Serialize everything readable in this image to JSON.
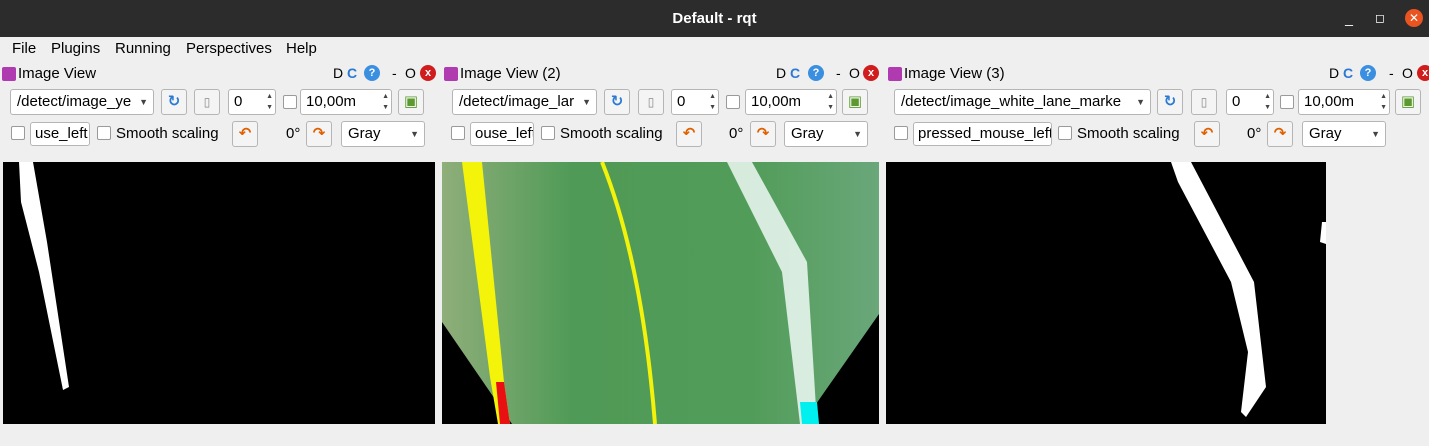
{
  "window": {
    "title": "Default - rqt",
    "min": "_",
    "max": "◻",
    "close": "✕"
  },
  "menu": [
    "File",
    "Plugins",
    "Running",
    "Perspectives",
    "Help"
  ],
  "panels": [
    {
      "title": "Image View",
      "topic": "/detect/image_ye",
      "spin": "0",
      "delay": "10,00m",
      "mouse_topic": "use_left",
      "smooth": "Smooth scaling",
      "rotation": "0°",
      "color": "Gray"
    },
    {
      "title": "Image View (2)",
      "topic": "/detect/image_lar",
      "spin": "0",
      "delay": "10,00m",
      "mouse_topic": "ouse_left",
      "smooth": "Smooth scaling",
      "rotation": "0°",
      "color": "Gray"
    },
    {
      "title": "Image View (3)",
      "topic": "/detect/image_white_lane_marke",
      "spin": "0",
      "delay": "10,00m",
      "mouse_topic": "pressed_mouse_left",
      "smooth": "Smooth scaling",
      "rotation": "0°",
      "color": "Gray"
    }
  ],
  "header_buttons": {
    "d": "D",
    "c": "C",
    "help": "?",
    "dash": "-",
    "o": "O",
    "x": "x"
  },
  "icons": {
    "refresh": "refresh-icon",
    "pause": "pause-icon",
    "save": "save-icon",
    "rotate_left": "rotate-left-icon",
    "rotate_right": "rotate-right-icon"
  },
  "colors": {
    "titlebar": "#2c2c2c",
    "close": "#e95420",
    "plugin_icon": "#b03ab0",
    "help": "#3a8fe0",
    "x_btn": "#d01c1c"
  }
}
